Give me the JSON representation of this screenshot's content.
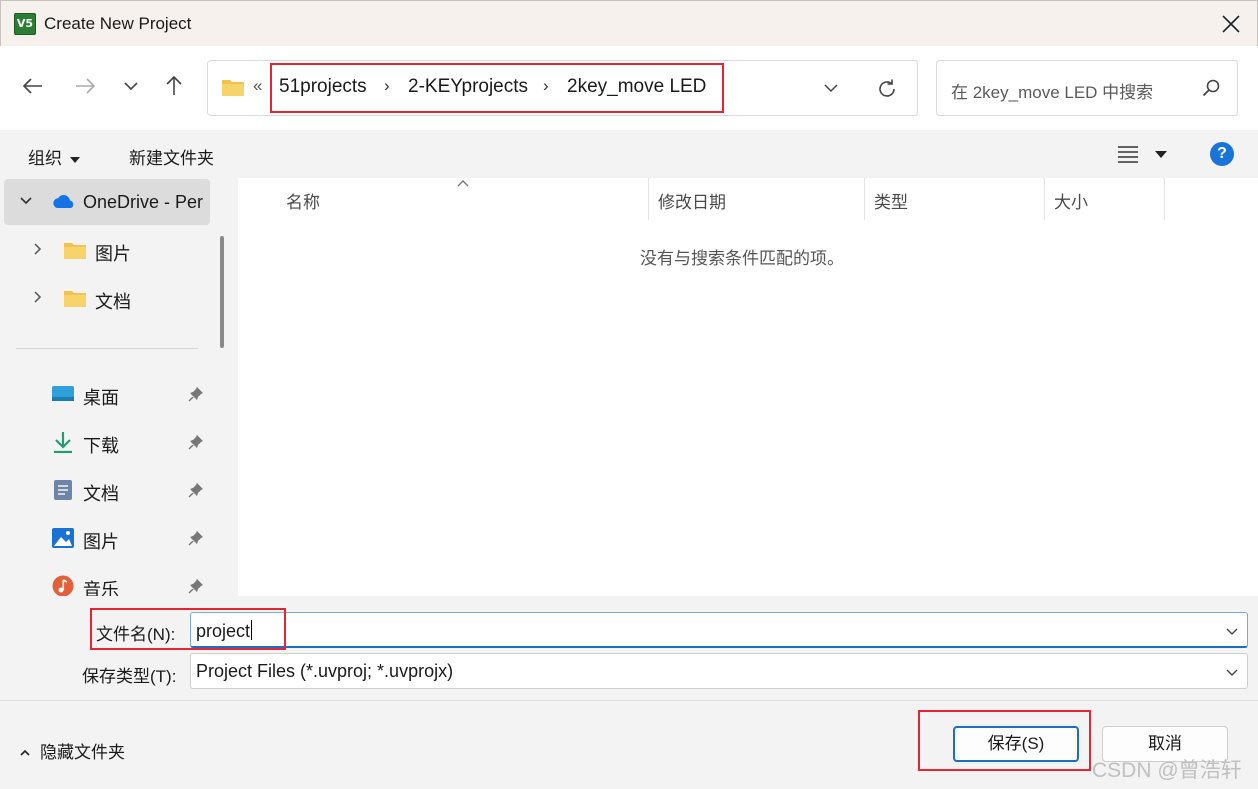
{
  "window": {
    "title": "Create New Project",
    "app_icon_text": "V5"
  },
  "address_bar": {
    "overflow_chevron": "«",
    "breadcrumbs": [
      "51projects",
      "2-KEYprojects",
      "2key_move LED"
    ],
    "separator": "›"
  },
  "search": {
    "placeholder": "在 2key_move LED 中搜索"
  },
  "command_bar": {
    "organize_label": "组织",
    "new_folder_label": "新建文件夹",
    "help_label": "?"
  },
  "sidebar": {
    "onedrive_label": "OneDrive - Per",
    "tree_items": [
      "图片",
      "文档"
    ],
    "quick_access": [
      {
        "label": "桌面",
        "icon": "desktop-icon"
      },
      {
        "label": "下载",
        "icon": "download-icon"
      },
      {
        "label": "文档",
        "icon": "document-icon"
      },
      {
        "label": "图片",
        "icon": "pictures-icon"
      },
      {
        "label": "音乐",
        "icon": "music-icon"
      }
    ]
  },
  "file_list": {
    "columns": [
      "名称",
      "修改日期",
      "类型",
      "大小"
    ],
    "empty_message": "没有与搜索条件匹配的项。"
  },
  "fields": {
    "filename_label": "文件名(N):",
    "filename_value": "project",
    "filetype_label": "保存类型(T):",
    "filetype_value": "Project Files (*.uvproj; *.uvprojx)"
  },
  "footer": {
    "hide_folders_label": "隐藏文件夹",
    "save_label": "保存(S)",
    "cancel_label": "取消",
    "watermark": "CSDN @曾浩轩"
  },
  "colors": {
    "highlight_box": "#e3262f",
    "accent": "#1a6fc4",
    "title_bar": "#f7f1ed"
  }
}
